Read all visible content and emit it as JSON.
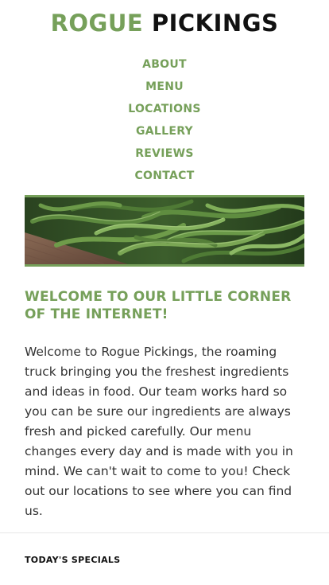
{
  "header": {
    "logo_part1": "ROGUE",
    "logo_part2": "PICKINGS"
  },
  "nav": {
    "items": [
      {
        "label": "ABOUT"
      },
      {
        "label": "MENU"
      },
      {
        "label": "LOCATIONS"
      },
      {
        "label": "GALLERY"
      },
      {
        "label": "REVIEWS"
      },
      {
        "label": "CONTACT"
      }
    ]
  },
  "hero": {
    "image": "green-beans-photo"
  },
  "welcome": {
    "title": "WELCOME TO OUR LITTLE CORNER OF THE INTERNET!",
    "body": "Welcome to Rogue Pickings, the roaming truck bringing you the freshest ingredients and ideas in food. Our team works hard so you can be sure our ingredients are always fresh and picked carefully. Our menu changes every day and is made with you in mind. We can't wait to come to you! Check out our locations to see where you can find us."
  },
  "specials": {
    "heading": "TODAY'S SPECIALS"
  },
  "colors": {
    "accent": "#76a05a",
    "text": "#333333"
  }
}
